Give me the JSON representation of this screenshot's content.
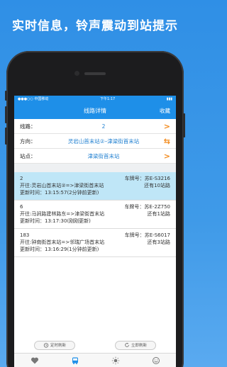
{
  "promo": {
    "headline": "实时信息，铃声震动到站提示"
  },
  "status": {
    "carrier": "●●●○○ 中国移动 ",
    "time": "下午1:17",
    "battery": "▮▮▮ "
  },
  "nav": {
    "title": "线路详情",
    "right_action": "收藏"
  },
  "form": {
    "line": {
      "label": "线路：",
      "value": "2",
      "arrow": ">"
    },
    "direction": {
      "label": "方向：",
      "value": "灵岩山首末站②–津梁街首末站",
      "arrow": "⇆"
    },
    "stop": {
      "label": "站点：",
      "value": "津梁街首末站",
      "arrow": ">"
    }
  },
  "buses": [
    {
      "route": "2",
      "plate": "车牌号：苏E-S3216",
      "departure": "开往:灵岩山首末站②=>津梁街首末站",
      "remaining": "还有10站路",
      "updated": "更新时间：13:15:57(2分钟前更新)"
    },
    {
      "route": "6",
      "plate": "车牌号：苏E-2Z750",
      "departure": "开往:马涧路建林路东=>津梁街首末站",
      "remaining": "还有1站路",
      "updated": "更新时间：13:17:30(刚刚更新)"
    },
    {
      "route": "183",
      "plate": "车牌号：苏E-S6017",
      "departure": "开往:钟南街首末站=>邻瑞广场首末站",
      "remaining": "还有3站路",
      "updated": "更新时间：13:16:29(1分钟前更新)"
    }
  ],
  "footer": {
    "timed_refresh": "定时刷新",
    "refresh_now": "立即刷新"
  },
  "tabs": [
    "heart-icon",
    "bus-icon",
    "sun-icon",
    "smile-icon"
  ]
}
